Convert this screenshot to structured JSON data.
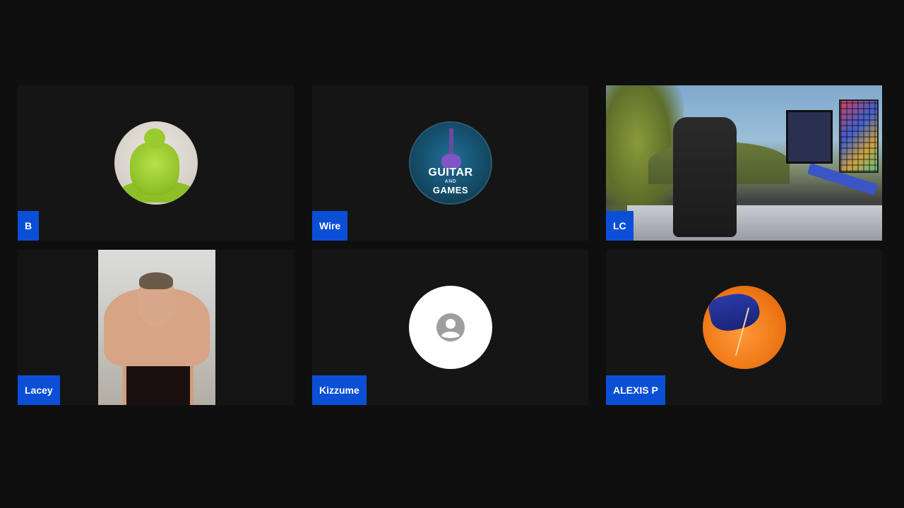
{
  "participants": [
    {
      "name": "B",
      "avatar": "green-figure-avatar"
    },
    {
      "name": "Wire",
      "avatar": "guitar-and-games-logo",
      "logo_text": [
        "GUITAR",
        "AND",
        "GAMES"
      ]
    },
    {
      "name": "LC",
      "avatar": "gaming-room-video"
    },
    {
      "name": "Lacey",
      "avatar": "webcam-video"
    },
    {
      "name": "Kizzume",
      "avatar": "default-person-icon"
    },
    {
      "name": "ALEXIS P",
      "avatar": "orange-photo-avatar"
    }
  ],
  "colors": {
    "background": "#0f0f0f",
    "tile": "#151515",
    "name_tag": "#0a4fd6",
    "name_text": "#ffffff"
  }
}
